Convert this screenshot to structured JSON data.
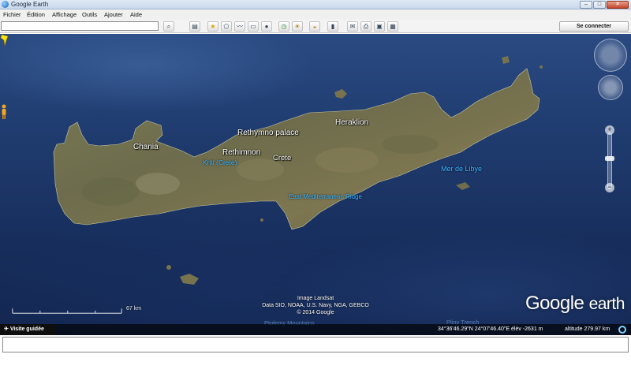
{
  "window": {
    "title": "Google Earth"
  },
  "menu": [
    "Fichier",
    "Édition",
    "Affichage",
    "Outils",
    "Ajouter",
    "Aide"
  ],
  "toolbar": {
    "search_value": "",
    "sign_in": "Se connecter",
    "icons": [
      "search-icon",
      "sidebar-icon",
      "placemark-icon",
      "polygon-icon",
      "path-icon",
      "overlay-icon",
      "tour-icon",
      "history-icon",
      "sun-icon",
      "planets-icon",
      "ruler-icon",
      "email-icon",
      "print-icon",
      "save-image-icon",
      "maps-icon"
    ]
  },
  "map": {
    "labels": {
      "chania": "Chania",
      "rethymno_palace": "Rethymno palace",
      "rethimnon": "Rethimnon",
      "kriti": "Kriti (Crete)",
      "crete": "Crete",
      "heraklion": "Heraklion",
      "mer_de_libye": "Mer de Libye",
      "ridge": "East Mediterranean Ridge",
      "ptolemy": "Ptolemy Mountains",
      "pliny": "Pliny Trench"
    },
    "scale": "67 km",
    "attribution": [
      "Image Landsat",
      "Data SIO, NOAA, U.S. Navy, NGA, GEBCO",
      "© 2014 Google"
    ],
    "logo": {
      "word1": "Google",
      "word2": "earth"
    }
  },
  "status": {
    "tour_label": "Visite guidée",
    "coords": "34°36'46.29\"N   24°07'46.40\"E   élév -2631 m",
    "altitude": "altitude  279.97 km"
  }
}
